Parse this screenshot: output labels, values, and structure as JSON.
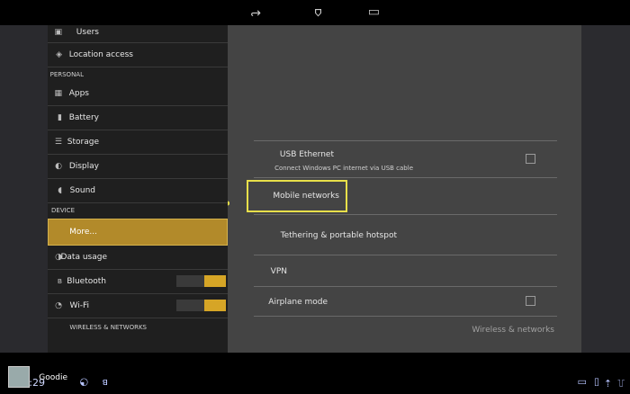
{
  "status_bar": {
    "time": "2:29"
  },
  "notification": {
    "text": "Goodie"
  },
  "nav": {
    "headers": {
      "wireless": "WIRELESS & NETWORKS",
      "device": "DEVICE",
      "personal": "PERSONAL"
    },
    "items": {
      "wifi": "Wi-Fi",
      "bluetooth": "Bluetooth",
      "data_usage": "Data usage",
      "more": "More...",
      "sound": "Sound",
      "display": "Display",
      "storage": "Storage",
      "battery": "Battery",
      "apps": "Apps",
      "users": "Users",
      "location": "Location access"
    },
    "selected": "more"
  },
  "detail": {
    "section_title": "Wireless & networks",
    "rows": {
      "airplane": "Airplane mode",
      "vpn": "VPN",
      "tethering": "Tethering & portable hotspot",
      "mobile": "Mobile networks",
      "usb_title": "USB Ethernet",
      "usb_sub": "Connect Windows PC internet via USB cable"
    }
  },
  "colors": {
    "accent": "#d6a526",
    "highlight": "#e8e04a",
    "notif_line": "#b58bff"
  },
  "icons": {
    "back": "back-arrow-icon",
    "home": "home-icon",
    "recents": "recents-icon"
  }
}
